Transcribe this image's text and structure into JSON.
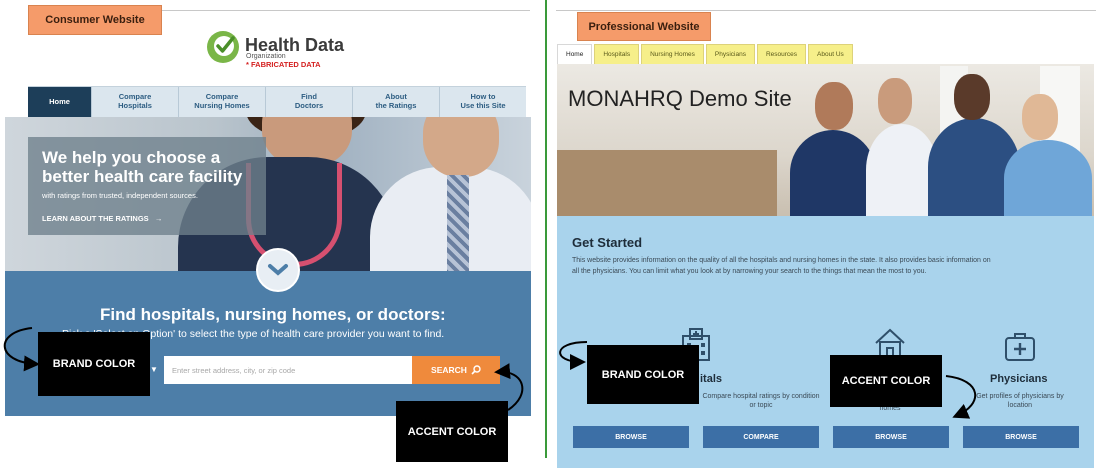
{
  "consumer": {
    "label": "Consumer Website",
    "logo": {
      "title": "Health Data",
      "subtitle": "Organization",
      "note": "* FABRICATED DATA",
      "icon": "checkmark-icon",
      "color": "#7ab648"
    },
    "nav": [
      {
        "label": "Home",
        "active": true
      },
      {
        "label": "Compare\nHospitals"
      },
      {
        "label": "Compare\nNursing Homes"
      },
      {
        "label": "Find\nDoctors"
      },
      {
        "label": "About\nthe Ratings"
      },
      {
        "label": "How to\nUse this Site"
      }
    ],
    "hero": {
      "headline": "We help you choose a better health care facility",
      "sub": "with ratings from trusted, independent sources.",
      "learn_more": "LEARN ABOUT THE RATINGS",
      "learn_more_icon": "arrow-right-icon"
    },
    "find": {
      "title": "Find hospitals, nursing homes, or doctors:",
      "instruction": "Pick a 'Select an Option' to select the type of health care provider you want to find.",
      "search_placeholder": "Enter street address, city, or zip code",
      "search_button": "SEARCH",
      "search_icon": "search-icon"
    },
    "colors": {
      "brand": "#4d7ea8",
      "accent": "#ef8a3c",
      "nav_active": "#1d3e59"
    }
  },
  "professional": {
    "label": "Professional Website",
    "tabs": [
      {
        "label": "Home",
        "active": true
      },
      {
        "label": "Hospitals"
      },
      {
        "label": "Nursing Homes"
      },
      {
        "label": "Physicians"
      },
      {
        "label": "Resources"
      },
      {
        "label": "About Us"
      }
    ],
    "site_title": "MONAHRQ Demo Site",
    "get_started": {
      "title": "Get Started",
      "text": "This website provides information on the quality of all the hospitals and nursing homes in the state. It also provides basic information on all the physicians. You can limit what you look at by narrowing your search to the things that mean the most to you."
    },
    "cards": [
      {
        "title": "Hospitals",
        "visible_title": "itals",
        "desc": "",
        "button": "BROWSE",
        "icon": "hospital-icon"
      },
      {
        "title": "",
        "desc": "Compare hospital ratings by condition or topic",
        "button": "COMPARE",
        "icon": ""
      },
      {
        "title": "",
        "desc": "homes",
        "button": "BROWSE",
        "icon": "nursing-home-icon"
      },
      {
        "title": "Physicians",
        "desc": "Get profiles of physicians by location",
        "button": "BROWSE",
        "icon": "medical-kit-icon"
      }
    ],
    "colors": {
      "brand": "#a9d3ec",
      "accent": "#3c6fa6",
      "tabs": "#f6ef8a"
    }
  },
  "callouts": {
    "brand_color": "BRAND COLOR",
    "accent_color": "ACCENT COLOR"
  },
  "divider_color": "#3a9a3a",
  "label_color": "#f59b6a"
}
